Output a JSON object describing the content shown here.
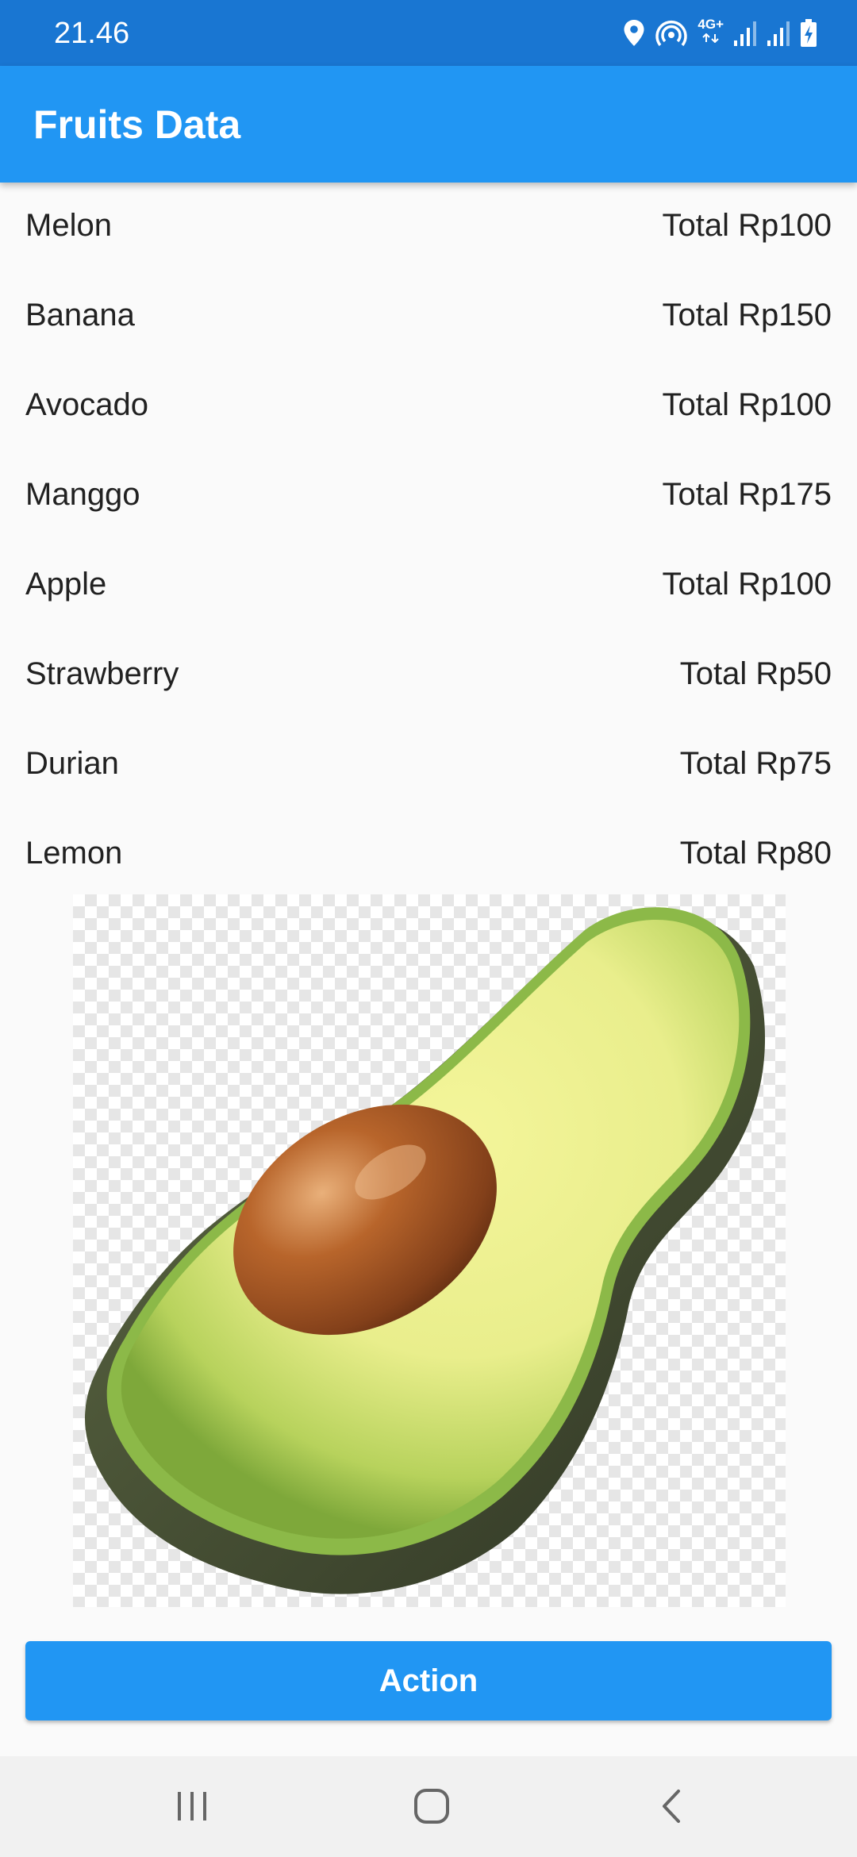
{
  "status_bar": {
    "time": "21.46",
    "network_label": "4G+",
    "icons": [
      "location-icon",
      "hotspot-icon",
      "network-4g-icon",
      "signal-icon",
      "signal-icon",
      "battery-charging-icon"
    ]
  },
  "app_bar": {
    "title": "Fruits Data"
  },
  "fruits": [
    {
      "name": "Melon",
      "total": "Total Rp100"
    },
    {
      "name": "Banana",
      "total": "Total Rp150"
    },
    {
      "name": "Avocado",
      "total": "Total Rp100"
    },
    {
      "name": "Manggo",
      "total": "Total Rp175"
    },
    {
      "name": "Apple",
      "total": "Total Rp100"
    },
    {
      "name": "Strawberry",
      "total": "Total Rp50"
    },
    {
      "name": "Durian",
      "total": "Total Rp75"
    },
    {
      "name": "Lemon",
      "total": "Total Rp80"
    }
  ],
  "image": {
    "subject": "avocado-half-image"
  },
  "action_button": {
    "label": "Action"
  },
  "nav_bar": {
    "buttons": [
      "recents-icon",
      "home-icon",
      "back-icon"
    ]
  },
  "colors": {
    "status_bar": "#1976d2",
    "app_bar": "#2196f3",
    "button": "#2196f3",
    "background": "#fafafa",
    "nav_bar": "#f1f1f1"
  }
}
